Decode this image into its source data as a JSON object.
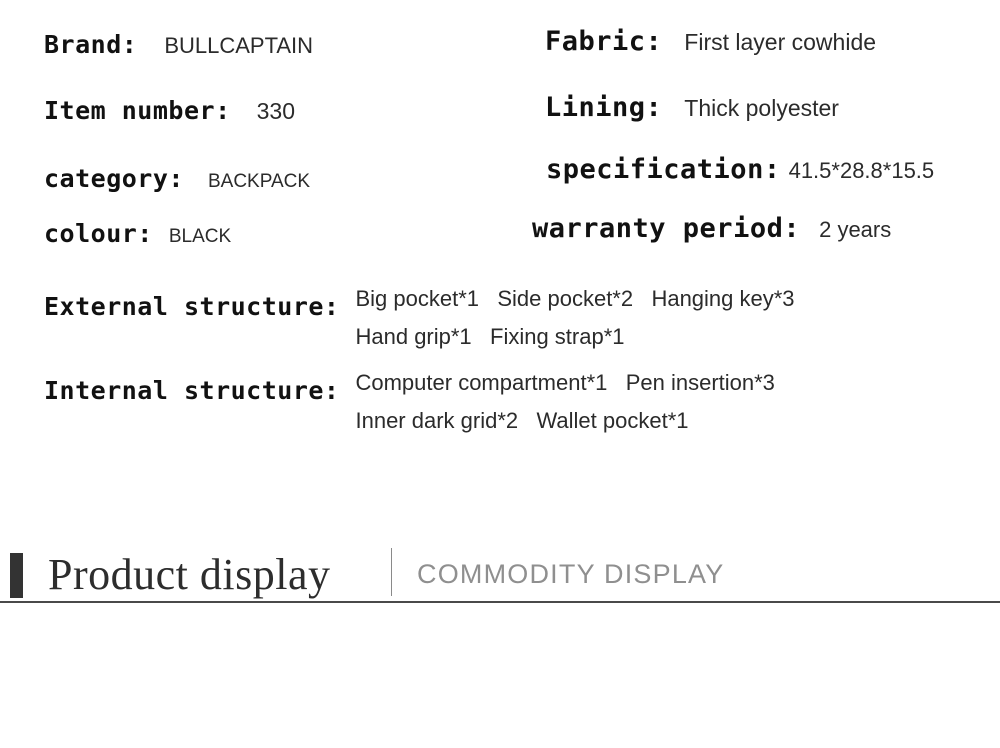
{
  "specs": {
    "left": [
      {
        "label": "Brand:",
        "value": "BULLCAPTAIN"
      },
      {
        "label": "Item number:",
        "value": "330"
      },
      {
        "label": "category:",
        "value": "BACKPACK"
      },
      {
        "label": "colour:",
        "value": "BLACK"
      }
    ],
    "right": [
      {
        "label": "Fabric:",
        "value": "First layer cowhide"
      },
      {
        "label": "Lining:",
        "value": "Thick polyester"
      },
      {
        "label": "specification:",
        "value": "41.5*28.8*15.5"
      },
      {
        "label": "warranty period:",
        "value": "2 years"
      }
    ],
    "structure": [
      {
        "label": "External structure:",
        "lines": [
          "Big pocket*1   Side pocket*2   Hanging key*3",
          "Hand grip*1   Fixing strap*1"
        ]
      },
      {
        "label": "Internal structure:",
        "lines": [
          "Computer compartment*1   Pen insertion*3",
          "Inner dark grid*2   Wallet pocket*1"
        ]
      }
    ]
  },
  "section": {
    "title": "Product display",
    "subtitle": "COMMODITY DISPLAY",
    "accent_color": "#333333",
    "rule_color": "#4a4a4a",
    "subtitle_color": "#8f8f8f"
  }
}
